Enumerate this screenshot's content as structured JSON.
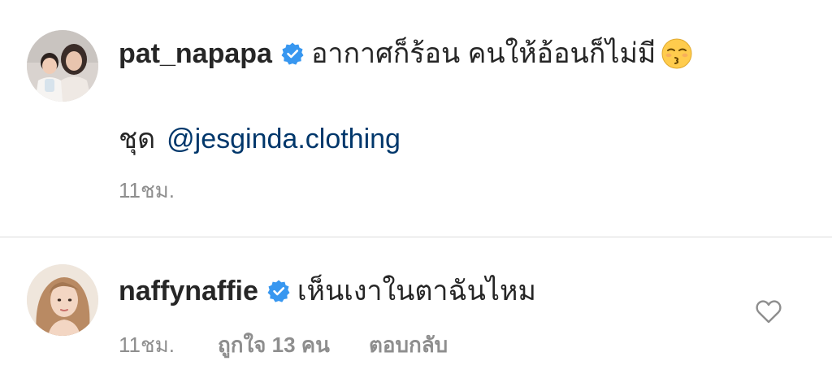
{
  "caption": {
    "username": "pat_napapa",
    "text": "อากาศก็ร้อน คนให้อ้อนก็ไม่มี",
    "emoji": "kissing-face-with-closed-eyes-icon",
    "outfit_label": "ชุด",
    "mention": "@jesginda.clothing",
    "time": "11ชม."
  },
  "comment": {
    "username": "naffynaffie",
    "text": "เห็นเงาในตาฉันไหม",
    "time": "11ชม.",
    "likes": "ถูกใจ 13 คน",
    "reply": "ตอบกลับ"
  },
  "colors": {
    "text": "#262626",
    "secondary": "#8e8e8e",
    "link": "#00376b",
    "verified": "#3897f0",
    "divider": "#dbdbdb"
  }
}
